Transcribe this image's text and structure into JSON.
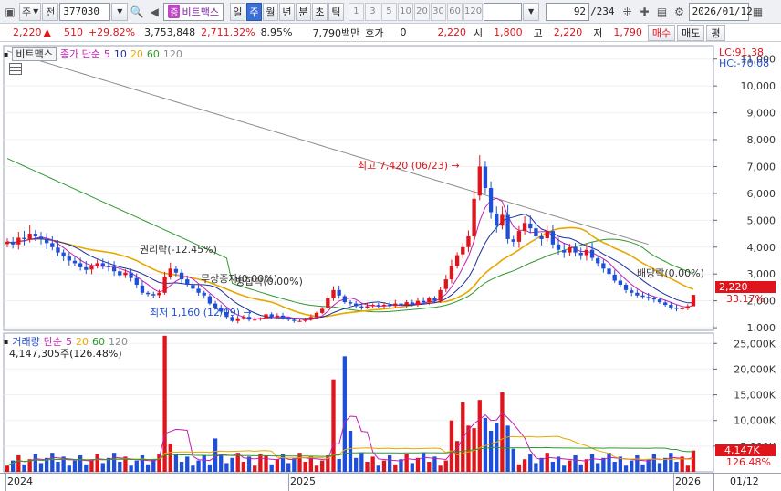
{
  "toolbar": {
    "market_type": "주",
    "prev_label": "전",
    "code": "377030",
    "stock_name": "비트맥스",
    "stock_badge": "증",
    "periods": [
      "일",
      "주",
      "월",
      "년",
      "분",
      "초",
      "틱"
    ],
    "active_period": "주",
    "numbers": [
      "1",
      "3",
      "5",
      "10",
      "20",
      "30",
      "60",
      "120"
    ],
    "count": "92",
    "count_total": "/234",
    "date": "2026/01/12"
  },
  "quote": {
    "price": "2,220",
    "change": "510",
    "change_pct": "+29.82%",
    "volume": "3,753,848",
    "volume_pct": "2,711.32%",
    "turnover": "8.95%",
    "amount": "7,790백만",
    "hoga_label": "호가",
    "hoga_value": "0",
    "hoga_price": "2,220",
    "open_label": "시",
    "open": "1,800",
    "high_label": "고",
    "high": "2,220",
    "low_label": "저",
    "low": "1,790",
    "buy_label": "매수",
    "sell_label": "매도",
    "eval_label": "평"
  },
  "price_panel": {
    "tab_label": "비트맥스",
    "ma_label": "종가 단순",
    "ma_periods": [
      "5",
      "10",
      "20",
      "60",
      "120"
    ],
    "lc_label": "LC:91.38",
    "hc_label": "HC:-70.08",
    "y_ticks": [
      "1,000",
      "2,000",
      "3,000",
      "4,000",
      "5,000",
      "6,000",
      "7,000",
      "8,000",
      "9,000",
      "10,000",
      "11,000"
    ],
    "current_price_tag": "2,220",
    "current_pct_tag": "33.17%",
    "annotations": {
      "high": "최고 7,420 (06/23)",
      "low": "최저 1,160 (12/09)",
      "rights": "권리락(-12.45%)",
      "free_issue": "무상증자(0.00%)",
      "merge": "병합락(0.00%)",
      "dividend": "배당락(0.00%)"
    }
  },
  "volume_panel": {
    "title": "거래량",
    "ma_label": "단순",
    "ma_periods": [
      "5",
      "20",
      "60",
      "120"
    ],
    "value_line": "4,147,305주(126.48%)",
    "y_ticks": [
      "5,000K",
      "10,000K",
      "15,000K",
      "20,000K",
      "25,000K"
    ],
    "current_tag": "4,147K",
    "current_pct_tag": "126.48%"
  },
  "x_axis": {
    "labels": [
      "2024",
      "2025",
      "2026"
    ],
    "right_label": "01/12"
  },
  "colors": {
    "up": "#e0151b",
    "down": "#1f4fd6",
    "ma5": "#c21fb4",
    "ma10": "#1d2f9a",
    "ma20": "#e6a800",
    "ma60": "#2c9a2c",
    "ma120": "#8c8c8c"
  },
  "chart_data": {
    "type": "candlestick",
    "x_range": [
      "2024",
      "2026/01/12"
    ],
    "price_ylim": [
      900,
      11500
    ],
    "volume_ylim": [
      0,
      27000000
    ],
    "annotations": [
      {
        "label": "최고",
        "value": 7420,
        "date": "06/23"
      },
      {
        "label": "최저",
        "value": 1160,
        "date": "12/09"
      }
    ],
    "last_candle": {
      "open": 1800,
      "high": 2220,
      "low": 1790,
      "close": 2220,
      "volume": 4147305
    }
  }
}
